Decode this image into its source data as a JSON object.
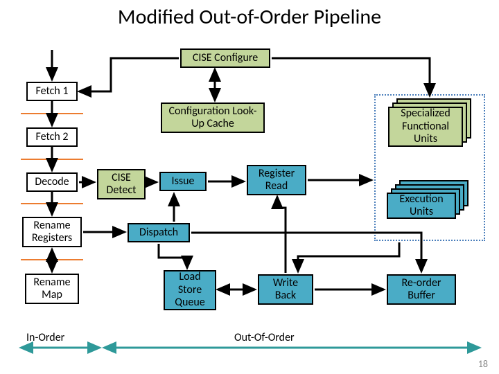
{
  "title": "Modified Out-of-Order Pipeline",
  "boxes": {
    "cise_configure": "CISE Configure",
    "fetch1": "Fetch 1",
    "fetch2": "Fetch 2",
    "decode": "Decode",
    "rename_registers": "Rename Registers",
    "rename_map": "Rename Map",
    "cise_detect": "CISE Detect",
    "config_cache": "Configuration Look-Up Cache",
    "issue": "Issue",
    "dispatch": "Dispatch",
    "register_read": "Register Read",
    "load_store_queue": "Load Store Queue",
    "write_back": "Write Back",
    "specialized_units": "Specialized Functional Units",
    "execution_units": "Execution Units",
    "reorder_buffer": "Re-order Buffer"
  },
  "labels": {
    "in_order": "In-Order",
    "out_of_order": "Out-Of-Order"
  },
  "page_number": "18"
}
